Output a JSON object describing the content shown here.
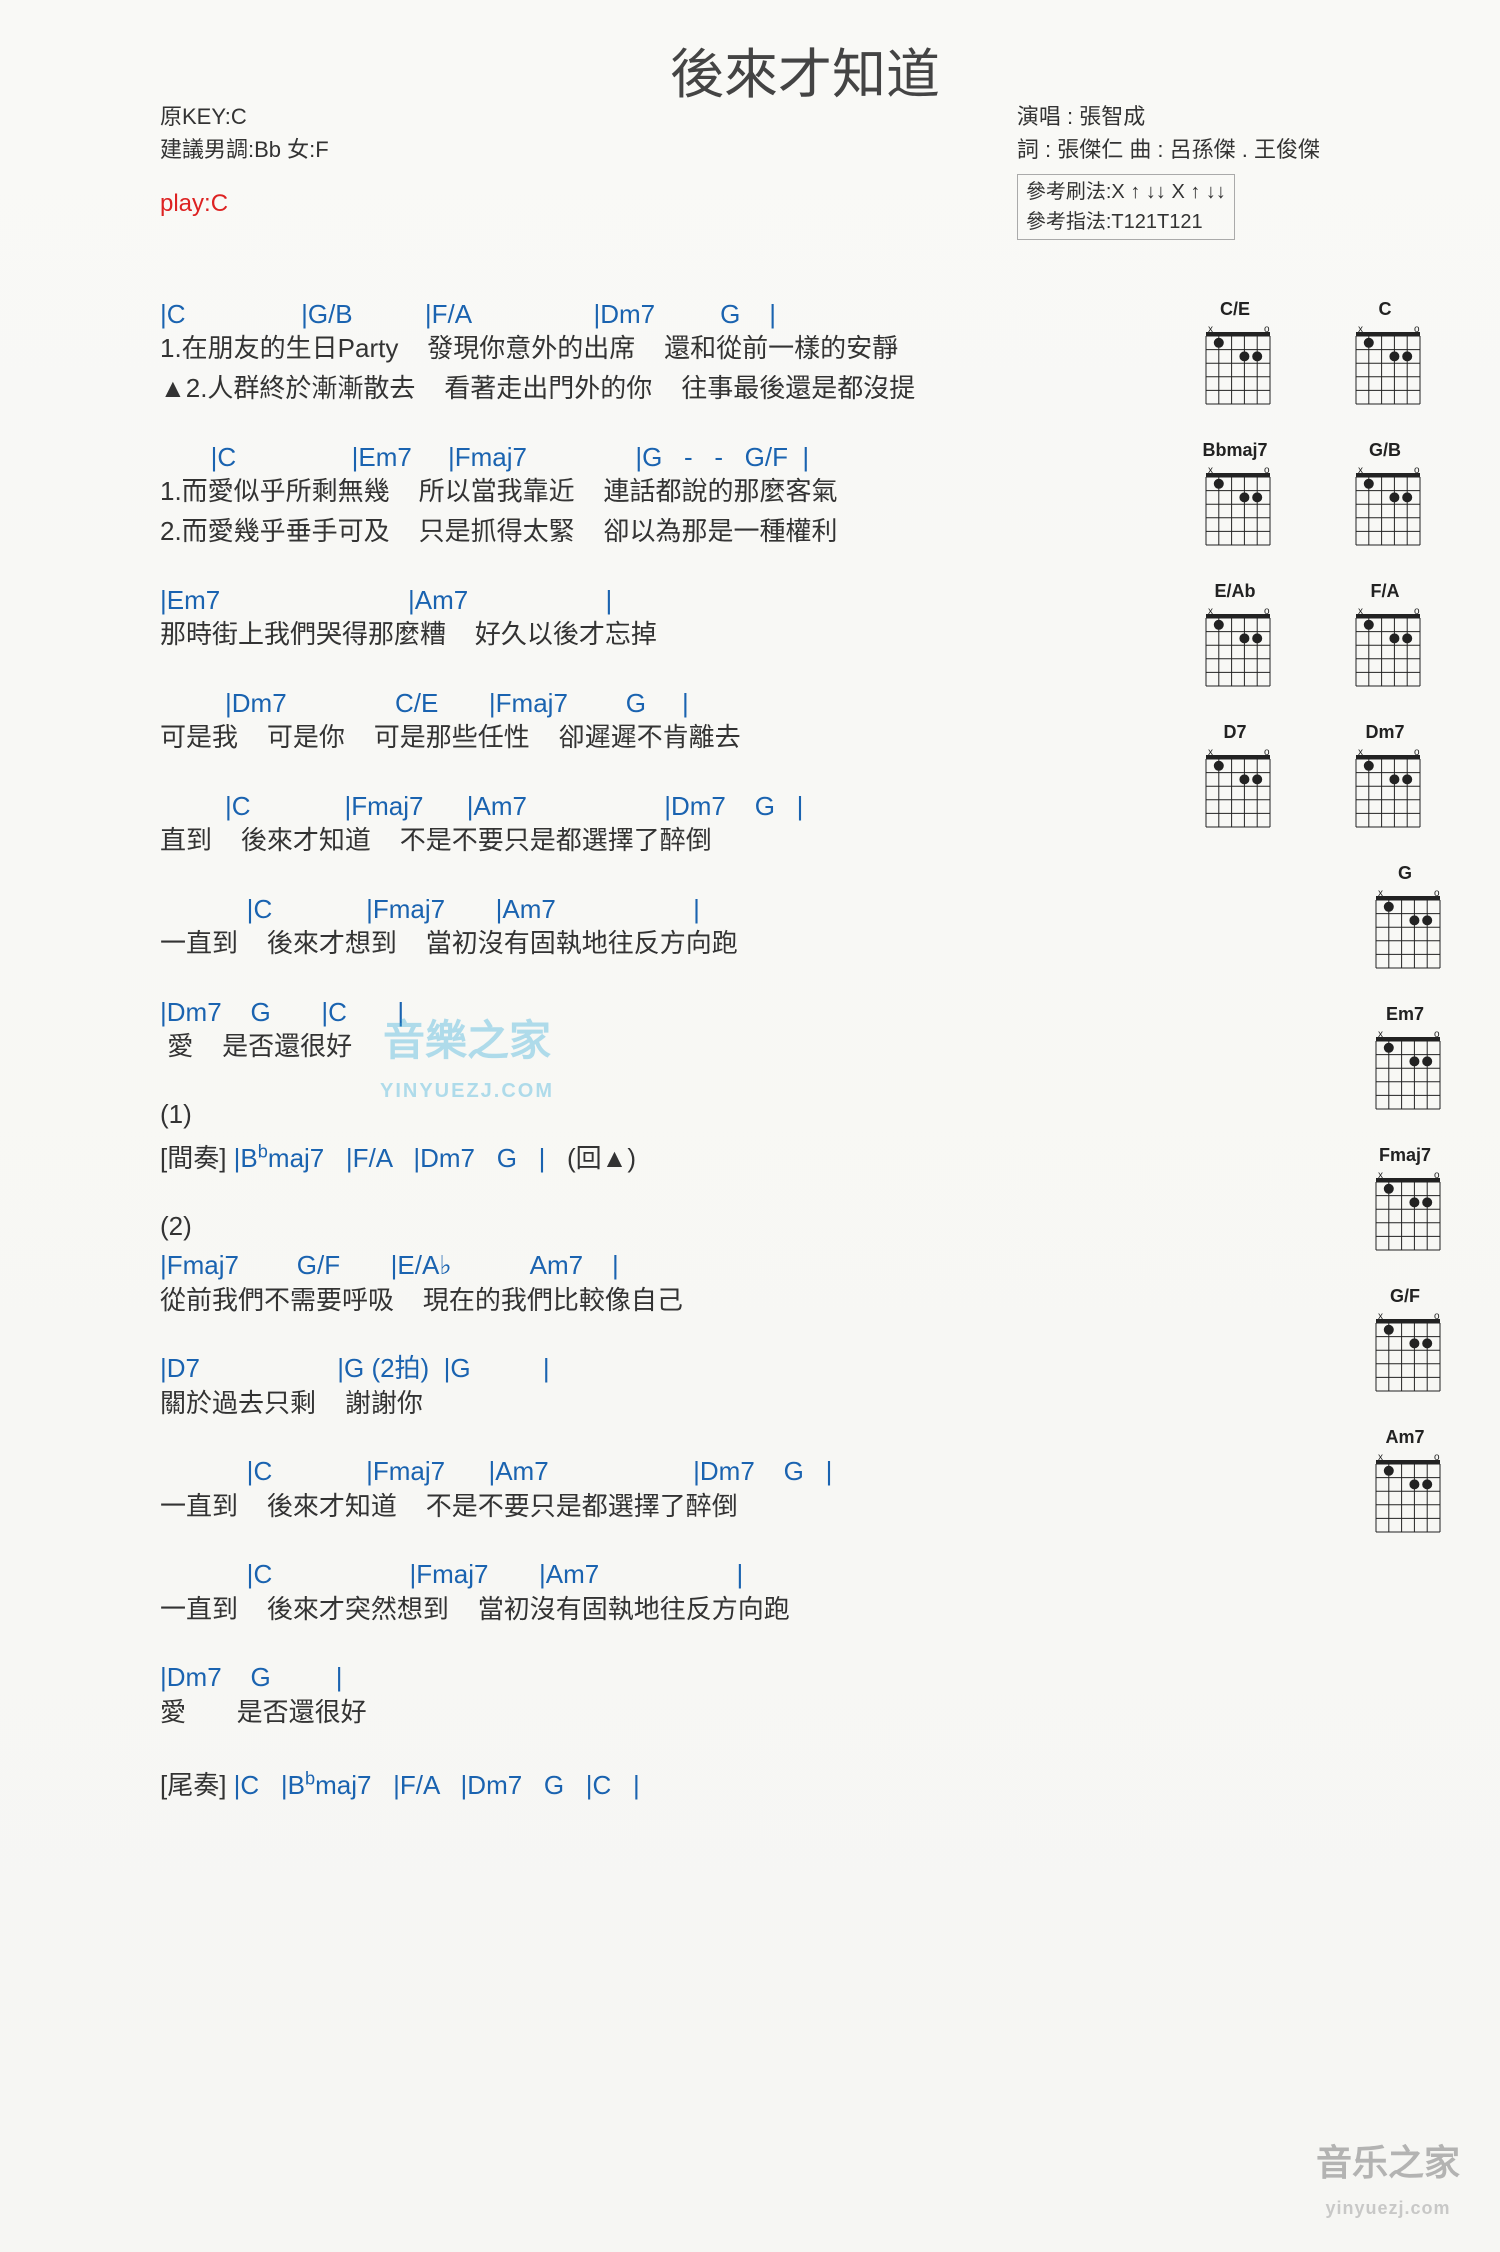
{
  "title": "後來才知道",
  "meta_left": {
    "line1": "原KEY:C",
    "line2": "建議男調:Bb 女:F",
    "play": "play:C"
  },
  "meta_right": {
    "line1": "演唱 : 張智成",
    "line2": "詞 : 張傑仁 曲 : 呂孫傑 . 王俊傑",
    "pattern1": "參考刷法:X ↑ ↓↓ X ↑ ↓↓",
    "pattern2": "參考指法:T121T121"
  },
  "blocks": [
    {
      "chords": "|C                |G/B          |F/A                 |Dm7         G    |",
      "lyrics": [
        "1.在朋友的生日Party    發現你意外的出席    還和從前一樣的安靜",
        "▲2.人群終於漸漸散去    看著走出門外的你    往事最後還是都沒提"
      ]
    },
    {
      "chords": "       |C                |Em7     |Fmaj7               |G   -   -   G/F  |",
      "lyrics": [
        "1.而愛似乎所剩無幾    所以當我靠近    連話都說的那麼客氣",
        "2.而愛幾乎垂手可及    只是抓得太緊    卻以為那是一種權利"
      ]
    },
    {
      "chords": "|Em7                          |Am7                   |",
      "lyrics": [
        "那時街上我們哭得那麼糟    好久以後才忘掉"
      ]
    },
    {
      "chords": "         |Dm7               C/E       |Fmaj7        G     |",
      "lyrics": [
        "可是我    可是你    可是那些任性    卻遲遲不肯離去"
      ]
    },
    {
      "chords": "         |C             |Fmaj7      |Am7                   |Dm7    G   |",
      "lyrics": [
        "直到    後來才知道    不是不要只是都選擇了醉倒"
      ]
    },
    {
      "chords": "            |C             |Fmaj7       |Am7                   |",
      "lyrics": [
        "一直到    後來才想到    當初沒有固執地往反方向跑"
      ]
    },
    {
      "chords": "|Dm7    G       |C       |",
      "lyrics": [
        " 愛    是否還很好"
      ]
    }
  ],
  "section1_label": "(1)",
  "interlude": {
    "prefix": "[間奏] ",
    "chords": "|B♭maj7   |F/A   |Dm7   G   |   ",
    "suffix": "(回▲)"
  },
  "section2_label": "(2)",
  "blocks2": [
    {
      "chords": "|Fmaj7        G/F       |E/A♭           Am7    |",
      "lyrics": [
        "從前我們不需要呼吸    現在的我們比較像自己"
      ]
    },
    {
      "chords": "|D7                   |G (2拍)  |G          |",
      "lyrics": [
        "關於過去只剩    謝謝你"
      ]
    },
    {
      "chords": "            |C             |Fmaj7      |Am7                    |Dm7    G   |",
      "lyrics": [
        "一直到    後來才知道    不是不要只是都選擇了醉倒"
      ]
    },
    {
      "chords": "            |C                   |Fmaj7       |Am7                   |",
      "lyrics": [
        "一直到    後來才突然想到    當初沒有固執地往反方向跑"
      ]
    },
    {
      "chords": "|Dm7    G         |",
      "lyrics": [
        "愛       是否還很好"
      ]
    }
  ],
  "outro": {
    "prefix": "[尾奏] ",
    "chords": "|C   |B♭maj7   |F/A   |Dm7   G   |C   |"
  },
  "chord_diagrams": [
    [
      "C/E",
      "C"
    ],
    [
      "Bbmaj7",
      "G/B"
    ],
    [
      "E/Ab",
      "F/A"
    ],
    [
      "D7",
      "Dm7"
    ],
    [
      "G"
    ],
    [
      "Em7"
    ],
    [
      "Fmaj7"
    ],
    [
      "G/F"
    ],
    [
      "Am7"
    ]
  ],
  "watermark": {
    "main": "音樂之家",
    "sub": "YINYUEZJ.COM"
  },
  "watermark_corner": {
    "main": "音乐之家",
    "sub": "yinyuezj.com"
  }
}
